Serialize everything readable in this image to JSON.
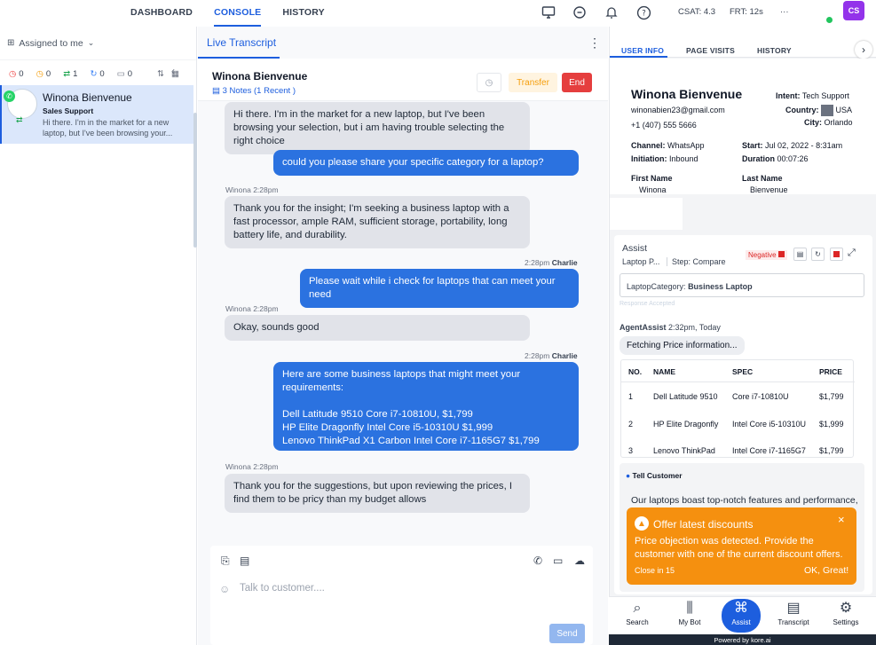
{
  "nav": {
    "items": [
      "DASHBOARD",
      "CONSOLE",
      "HISTORY"
    ],
    "active": "CONSOLE"
  },
  "topbar": {
    "csat": "CSAT: 4.3",
    "frt": "FRT: 12s",
    "more": "···",
    "avatar": "CS"
  },
  "left": {
    "filter_label": "Assigned to me",
    "counts": {
      "red": "0",
      "orange": "0",
      "green": "1",
      "blue": "0",
      "grey": "0"
    },
    "conversation": {
      "name": "Winona Bienvenue",
      "queue": "Sales Support",
      "preview": "Hi there. I'm in the market for a new laptop, but I've been browsing your..."
    }
  },
  "chat": {
    "tab": "Live Transcript",
    "customer": "Winona Bienvenue",
    "notes": "3 Notes (1 Recent )",
    "transfer": "Transfer",
    "end": "End",
    "messages": [
      {
        "text": "Hi there. I'm in the market for a new laptop, but I've been browsing your selection, but i am having trouble selecting the right choice"
      },
      {
        "text": "could you please share your specific category for a laptop?"
      },
      {
        "sender": "Winona",
        "time": "2:28pm",
        "text": "Thank you for the insight; I'm seeking a business laptop with a fast processor, ample RAM, sufficient storage, portability, long battery life, and durability."
      },
      {
        "time": "2:28pm",
        "sender": "Charlie",
        "text": "Please wait while i check for laptops that can meet your need"
      },
      {
        "sender": "Winona",
        "time": "2:28pm",
        "text": "Okay, sounds good"
      },
      {
        "time": "2:28pm",
        "sender": "Charlie",
        "text": "Here are some business laptops that might meet your requirements:",
        "lines": [
          "Dell Latitude 9510 Core i7-10810U,   $1,799",
          "HP Elite Dragonfly Intel Core i5-10310U   $1,999",
          "Lenovo ThinkPad X1 Carbon Intel Core i7-1165G7   $1,799"
        ]
      },
      {
        "sender": "Winona",
        "time": "2:28pm",
        "text": "Thank you for the suggestions, but upon reviewing the prices, I find them to be pricy than my budget allows"
      }
    ],
    "input_placeholder": "Talk to customer....",
    "send": "Send"
  },
  "right": {
    "tabs": [
      "USER INFO",
      "PAGE VISITS",
      "HISTORY"
    ],
    "user": {
      "name": "Winona Bienvenue",
      "email": "winonabien23@gmail.com",
      "phone": "+1 (407) 555 5666",
      "intent_label": "Intent:",
      "intent": "Tech Support",
      "country_label": "Country:",
      "country": "USA",
      "city_label": "City:",
      "city": "Orlando",
      "channel_label": "Channel:",
      "channel": "WhatsApp",
      "initiation_label": "Initiation:",
      "initiation": "Inbound",
      "start_label": "Start:",
      "start": "Jul 02, 2022 - 8:31am",
      "duration_label": "Duration",
      "duration": "00:07:26",
      "first_label": "First Name",
      "first": "Winona",
      "last_label": "Last Name",
      "last": "Bienvenue"
    },
    "assist": {
      "title": "Assist",
      "crumb": "Laptop P...",
      "step": "Step: Compare",
      "sentiment": "Negative",
      "category_label": "LaptopCategory:",
      "category": "Business Laptop",
      "accepted": "Response Accepted",
      "agent_assist": "AgentAssist",
      "agent_time": "2:32pm, Today",
      "fetching": "Fetching Price information...",
      "table": {
        "headers": [
          "NO.",
          "NAME",
          "SPEC",
          "PRICE"
        ],
        "rows": [
          [
            "1",
            "Dell Latitude 9510",
            "Core i7-10810U",
            "$1,799"
          ],
          [
            "2",
            "HP Elite Dragonfly",
            "Intel Core i5-10310U",
            "$1,999"
          ],
          [
            "3",
            "Lenovo ThinkPad",
            "Intel Core i7-1165G7",
            "$1,799"
          ]
        ]
      },
      "tell_title": "Tell Customer",
      "tell_text": "Our laptops boast top-notch features and performance,"
    },
    "toast": {
      "title": "Offer latest discounts",
      "text": "Price objection was detected. Provide the customer with one of the current discount offers.",
      "close_in": "Close in 15",
      "ok": "OK, Great!"
    },
    "bottom": [
      "Search",
      "My Bot",
      "Assist",
      "Transcript",
      "Settings"
    ],
    "powered": "Powered by kore.ai"
  },
  "colors": {
    "accent": "#1d5ede",
    "agent_bubble": "#2b72e0",
    "end": "#e53e3e",
    "toast": "#f5900f"
  }
}
